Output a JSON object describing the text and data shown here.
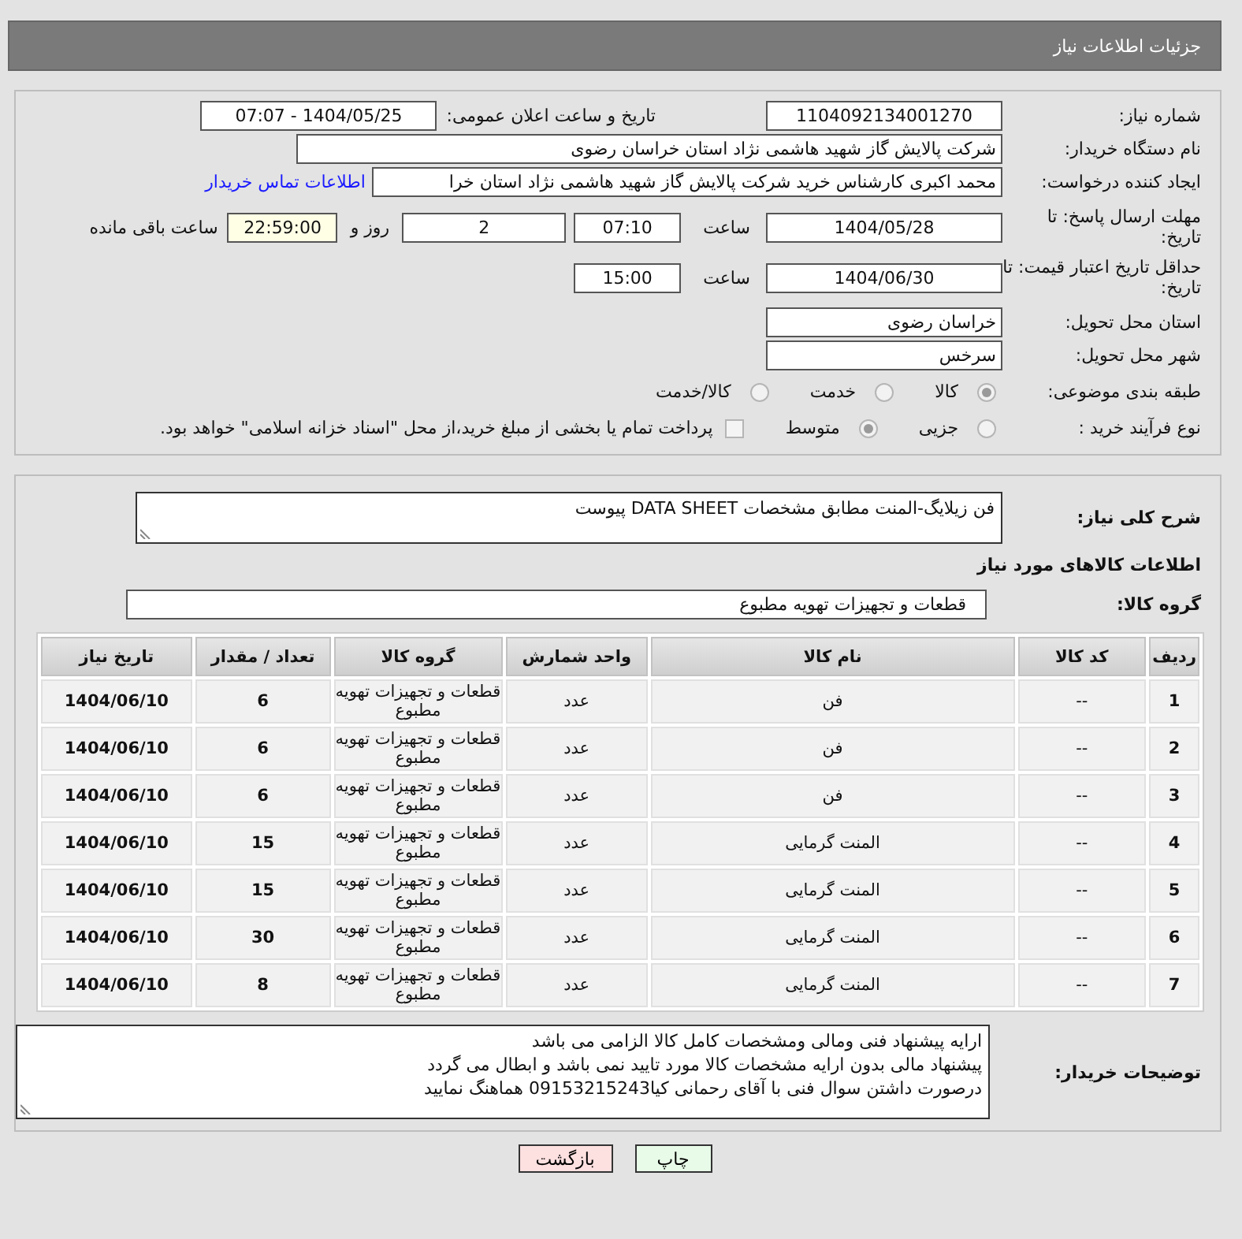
{
  "title": "جزئیات اطلاعات نیاز",
  "need_number": {
    "label": "شماره نیاز:",
    "value": "1104092134001270"
  },
  "announce": {
    "label": "تاریخ و ساعت اعلان عمومی:",
    "value": "1404/05/25 - 07:07"
  },
  "buyer_org": {
    "label": "نام دستگاه خریدار:",
    "value": "شرکت پالایش گاز شهید هاشمی نژاد   استان خراسان رضوی"
  },
  "requester": {
    "label": "ایجاد کننده درخواست:",
    "value": "محمد اکبری کارشناس خرید شرکت پالایش گاز شهید هاشمی نژاد   استان خرا",
    "link": "اطلاعات تماس خریدار"
  },
  "reply_deadline": {
    "label": "مهلت ارسال پاسخ: تا تاریخ:",
    "date": "1404/05/28",
    "time_label": "ساعت",
    "time": "07:10",
    "days": "2",
    "days_label": "روز و",
    "remaining": "22:59:00",
    "remaining_label": "ساعت باقی مانده"
  },
  "price_validity": {
    "label": "حداقل تاریخ اعتبار قیمت: تا تاریخ:",
    "date": "1404/06/30",
    "time_label": "ساعت",
    "time": "15:00"
  },
  "delivery_province": {
    "label": "استان محل تحویل:",
    "value": "خراسان رضوی"
  },
  "delivery_city": {
    "label": "شهر محل تحویل:",
    "value": "سرخس"
  },
  "category": {
    "label": "طبقه بندی موضوعی:",
    "options": [
      {
        "label": "کالا",
        "selected": true
      },
      {
        "label": "خدمت",
        "selected": false
      },
      {
        "label": "کالا/خدمت",
        "selected": false
      }
    ]
  },
  "purchase_type": {
    "label": "نوع فرآیند خرید :",
    "options": [
      {
        "label": "جزیی",
        "selected": false
      },
      {
        "label": "متوسط",
        "selected": true
      }
    ],
    "treasury": {
      "label": "پرداخت تمام یا بخشی از مبلغ خرید،از محل \"اسناد خزانه اسلامی\" خواهد بود.",
      "checked": false
    }
  },
  "description": {
    "label": "شرح کلی نیاز:",
    "value": "فن زیلایگ-المنت مطابق مشخصات DATA SHEET پیوست"
  },
  "items_heading": "اطلاعات کالاهای مورد نیاز",
  "goods_group": {
    "label": "گروه کالا:",
    "value": "قطعات و تجهیزات تهویه مطبوع"
  },
  "table": {
    "columns": [
      "ردیف",
      "کد کالا",
      "نام کالا",
      "واحد شمارش",
      "گروه کالا",
      "تعداد / مقدار",
      "تاریخ نیاز"
    ],
    "rows": [
      [
        "1",
        "--",
        "فن",
        "عدد",
        "قطعات و تجهیزات تهویه مطبوع",
        "6",
        "1404/06/10"
      ],
      [
        "2",
        "--",
        "فن",
        "عدد",
        "قطعات و تجهیزات تهویه مطبوع",
        "6",
        "1404/06/10"
      ],
      [
        "3",
        "--",
        "فن",
        "عدد",
        "قطعات و تجهیزات تهویه مطبوع",
        "6",
        "1404/06/10"
      ],
      [
        "4",
        "--",
        "المنت گرمایی",
        "عدد",
        "قطعات و تجهیزات تهویه مطبوع",
        "15",
        "1404/06/10"
      ],
      [
        "5",
        "--",
        "المنت گرمایی",
        "عدد",
        "قطعات و تجهیزات تهویه مطبوع",
        "15",
        "1404/06/10"
      ],
      [
        "6",
        "--",
        "المنت گرمایی",
        "عدد",
        "قطعات و تجهیزات تهویه مطبوع",
        "30",
        "1404/06/10"
      ],
      [
        "7",
        "--",
        "المنت گرمایی",
        "عدد",
        "قطعات و تجهیزات تهویه مطبوع",
        "8",
        "1404/06/10"
      ]
    ]
  },
  "buyer_notes": {
    "label": "توضیحات خریدار:",
    "lines": [
      "ارایه پیشنهاد فنی ومالی ومشخصات کامل کالا الزامی می باشد",
      "پیشنهاد مالی بدون ارایه مشخصات کالا مورد تایید نمی باشد و ابطال می گردد",
      "درصورت داشتن سوال فنی با آقای رحمانی کیا09153215243 هماهنگ نمایید"
    ]
  },
  "buttons": [
    {
      "label": "چاپ",
      "kind": "print"
    },
    {
      "label": "بازگشت",
      "kind": "back"
    }
  ]
}
